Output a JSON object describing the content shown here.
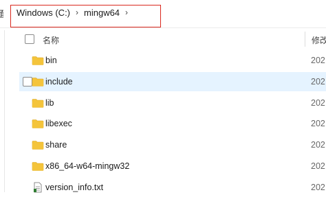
{
  "sidebar_edge_text": "面",
  "breadcrumb": {
    "items": [
      {
        "label": "Windows (C:)"
      },
      {
        "label": "mingw64"
      }
    ],
    "separator": "›"
  },
  "columns": {
    "name": "名称",
    "modified": "修改"
  },
  "files": [
    {
      "name": "bin",
      "type": "folder",
      "date": "202"
    },
    {
      "name": "include",
      "type": "folder",
      "date": "202",
      "hover": true
    },
    {
      "name": "lib",
      "type": "folder",
      "date": "202"
    },
    {
      "name": "libexec",
      "type": "folder",
      "date": "202"
    },
    {
      "name": "share",
      "type": "folder",
      "date": "202"
    },
    {
      "name": "x86_64-w64-mingw32",
      "type": "folder",
      "date": "202"
    },
    {
      "name": "version_info.txt",
      "type": "text-file",
      "date": "202"
    }
  ],
  "colors": {
    "highlight_box": "#d9261c",
    "hover_row": "#e5f3ff",
    "folder": "#f4c43b"
  }
}
